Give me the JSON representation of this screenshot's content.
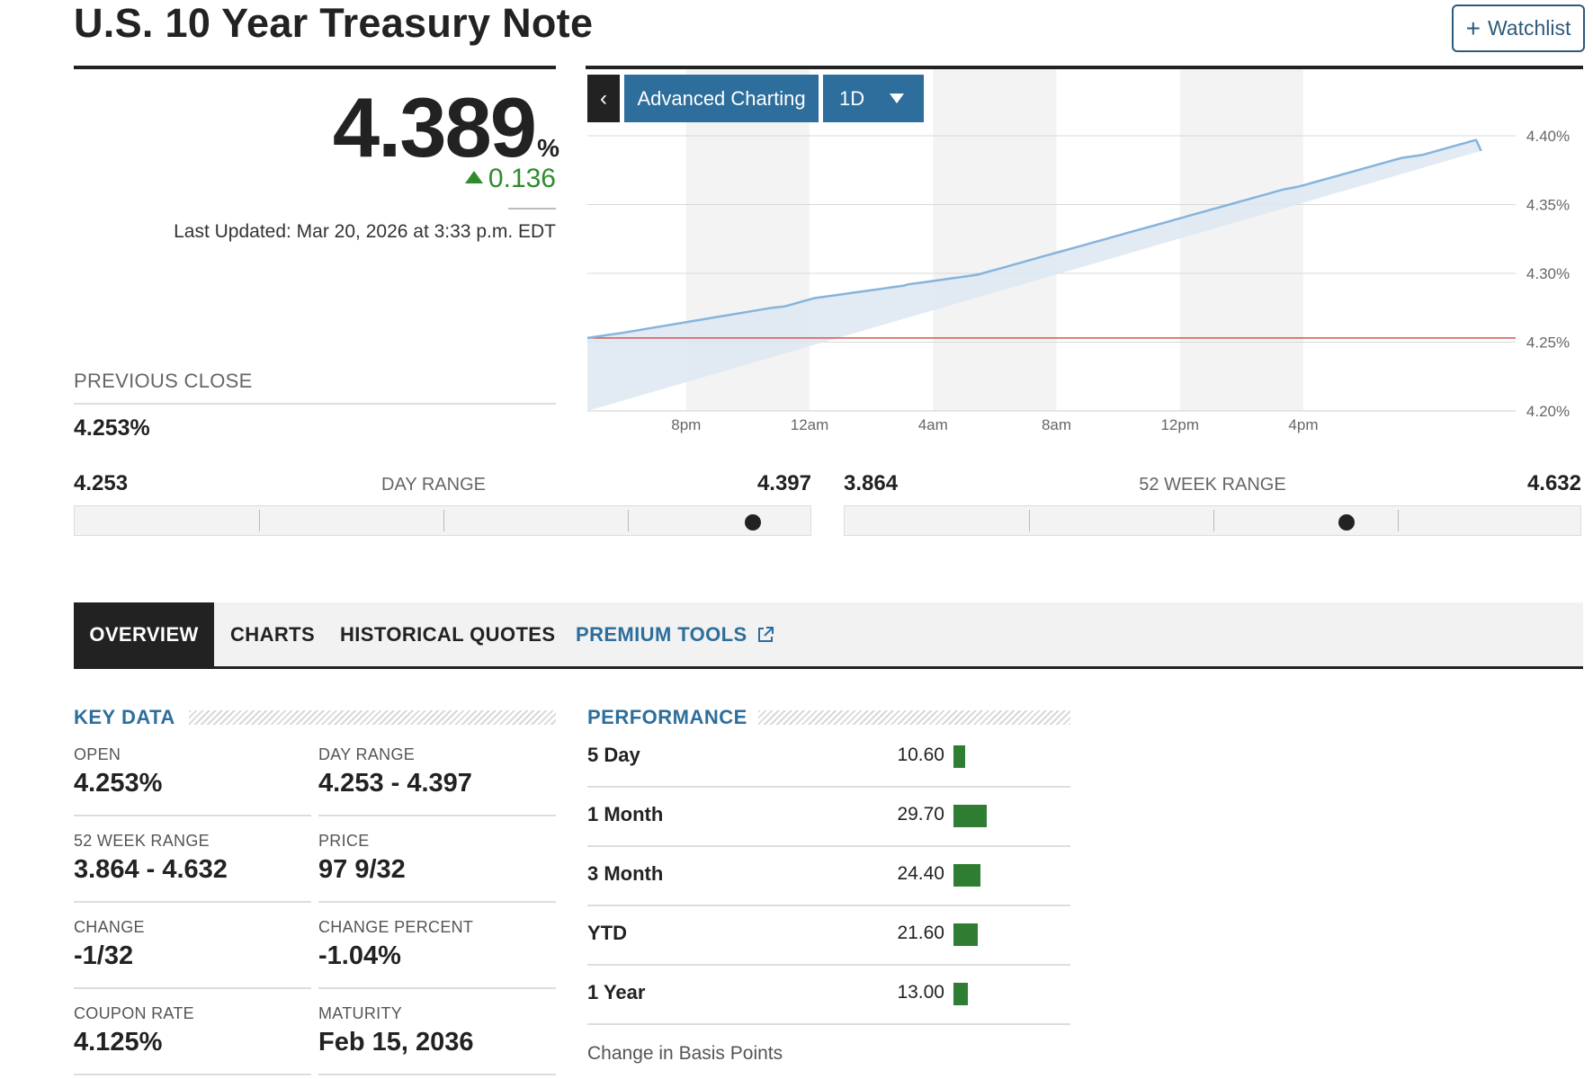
{
  "header": {
    "title": "U.S. 10 Year Treasury Note",
    "watchlist_label": "Watchlist",
    "watchlist_plus": "+"
  },
  "quote": {
    "price": "4.389",
    "unit": "%",
    "change": "0.136",
    "change_direction": "up",
    "last_updated": "Last Updated: Mar 20, 2026 at 3:33 p.m. EDT",
    "previous_close_label": "PREVIOUS CLOSE",
    "previous_close_value": "4.253%"
  },
  "chart_controls": {
    "back_label": "‹",
    "advanced_label": "Advanced Charting",
    "range_label": "1D"
  },
  "chart_data": {
    "type": "area",
    "x_labels": [
      "8pm",
      "12am",
      "4am",
      "8am",
      "12pm",
      "4pm"
    ],
    "y_ticks": [
      "4.40%",
      "4.35%",
      "4.30%",
      "4.25%",
      "4.20%"
    ],
    "ylim": [
      4.2,
      4.4
    ],
    "previous_close": 4.253,
    "x_hours": [
      0,
      1.5,
      2.5,
      3.5,
      4.5,
      5.5,
      6.5,
      7.5,
      8,
      8.2,
      8.4,
      8.6,
      8.8,
      9,
      9.2,
      9.6,
      10,
      10.4,
      10.8,
      11.2,
      11.6,
      12,
      12.4,
      12.8,
      13,
      13.4,
      13.8,
      14.2,
      14.6,
      15,
      15.4,
      15.8,
      16,
      16.2,
      16.4,
      16.6,
      16.8,
      17,
      17.2,
      17.4,
      17.6,
      17.8,
      18,
      18.2,
      18.4,
      18.6,
      18.8,
      19,
      19.2,
      19.4,
      19.6,
      19.8,
      20,
      20.2,
      20.4,
      20.6,
      20.8,
      21,
      21.2,
      21.4,
      21.6,
      21.8,
      22,
      22.2,
      22.4,
      22.6,
      22.8,
      23,
      23.2,
      23.4,
      23.6,
      23.8,
      24,
      24.2,
      24.4,
      24.6,
      24.8,
      25,
      25.2,
      25.4,
      25.6,
      25.8,
      26,
      26.2,
      26.4,
      26.6,
      26.8,
      27,
      27.2,
      27.4,
      27.6,
      27.8,
      28,
      28.2,
      28.5,
      28.8,
      29,
      29.2,
      29.4,
      29.6,
      29.8,
      30,
      30.2,
      30.4,
      30.6,
      30.8,
      31,
      31.2,
      31.4,
      31.6,
      31.8,
      32,
      32.2,
      32.4,
      32.6,
      32.8,
      33,
      33.4,
      33.8,
      34,
      34.2,
      34.4,
      34.6,
      34.8,
      35,
      35.2,
      35.4,
      35.6,
      35.8,
      36,
      36.2,
      36.4,
      36.6,
      36.8
    ],
    "values": [
      4.253,
      4.257,
      4.26,
      4.263,
      4.266,
      4.269,
      4.272,
      4.275,
      4.276,
      4.277,
      4.278,
      4.279,
      4.28,
      4.281,
      4.282,
      4.283,
      4.284,
      4.285,
      4.286,
      4.287,
      4.288,
      4.289,
      4.29,
      4.291,
      4.292,
      4.293,
      4.294,
      4.295,
      4.296,
      4.297,
      4.298,
      4.299,
      4.3,
      4.301,
      4.302,
      4.303,
      4.304,
      4.305,
      4.306,
      4.307,
      4.308,
      4.309,
      4.31,
      4.311,
      4.312,
      4.313,
      4.314,
      4.315,
      4.316,
      4.317,
      4.318,
      4.319,
      4.32,
      4.321,
      4.322,
      4.323,
      4.324,
      4.325,
      4.326,
      4.327,
      4.328,
      4.329,
      4.33,
      4.331,
      4.332,
      4.333,
      4.334,
      4.335,
      4.336,
      4.337,
      4.338,
      4.339,
      4.34,
      4.341,
      4.342,
      4.343,
      4.344,
      4.345,
      4.346,
      4.347,
      4.348,
      4.349,
      4.35,
      4.351,
      4.352,
      4.353,
      4.354,
      4.355,
      4.356,
      4.357,
      4.358,
      4.359,
      4.36,
      4.361,
      4.362,
      4.363,
      4.364,
      4.365,
      4.366,
      4.367,
      4.368,
      4.369,
      4.37,
      4.371,
      4.372,
      4.373,
      4.374,
      4.375,
      4.376,
      4.377,
      4.378,
      4.379,
      4.38,
      4.381,
      4.382,
      4.383,
      4.384,
      4.385,
      4.386,
      4.387,
      4.388,
      4.389,
      4.39,
      4.391,
      4.392,
      4.393,
      4.394,
      4.395,
      4.396,
      4.397,
      4.389
    ]
  },
  "day_range": {
    "low": "4.253",
    "high": "4.397",
    "title": "DAY RANGE",
    "position_fraction": 0.92
  },
  "week52_range": {
    "low": "3.864",
    "high": "4.632",
    "title": "52 WEEK RANGE",
    "position_fraction": 0.68
  },
  "tabs": [
    {
      "label": "OVERVIEW",
      "active": true
    },
    {
      "label": "CHARTS"
    },
    {
      "label": "HISTORICAL QUOTES"
    },
    {
      "label": "PREMIUM TOOLS",
      "external": true
    }
  ],
  "key_data": {
    "title": "KEY DATA",
    "items": [
      {
        "label": "OPEN",
        "value": "4.253%"
      },
      {
        "label": "DAY RANGE",
        "value": "4.253 - 4.397"
      },
      {
        "label": "52 WEEK RANGE",
        "value": "3.864 - 4.632"
      },
      {
        "label": "PRICE",
        "value": "97 9/32"
      },
      {
        "label": "CHANGE",
        "value": "-1/32"
      },
      {
        "label": "CHANGE PERCENT",
        "value": "-1.04%"
      },
      {
        "label": "COUPON RATE",
        "value": "4.125%"
      },
      {
        "label": "MATURITY",
        "value": "Feb 15, 2036"
      }
    ]
  },
  "performance": {
    "title": "PERFORMANCE",
    "rows": [
      {
        "label": "5 Day",
        "value": "10.60",
        "amount": 10.6
      },
      {
        "label": "1 Month",
        "value": "29.70",
        "amount": 29.7
      },
      {
        "label": "3 Month",
        "value": "24.40",
        "amount": 24.4
      },
      {
        "label": "YTD",
        "value": "21.60",
        "amount": 21.6
      },
      {
        "label": "1 Year",
        "value": "13.00",
        "amount": 13.0
      }
    ],
    "note": "Change in Basis Points"
  },
  "colors": {
    "accent": "#2d6e9c",
    "positive": "#2e8b2e",
    "line": "#86b4dc",
    "area": "#dde7f1",
    "prev_close_line": "#d9534f",
    "perf_bar": "#2e7d32"
  }
}
